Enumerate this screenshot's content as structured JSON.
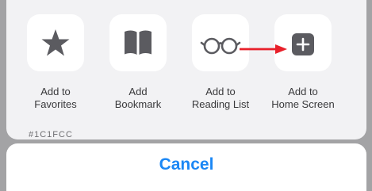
{
  "share_sheet": {
    "actions": [
      {
        "label": "Add to\nFavorites",
        "icon": "star-icon"
      },
      {
        "label": "Add\nBookmark",
        "icon": "book-icon"
      },
      {
        "label": "Add to\nReading List",
        "icon": "glasses-icon"
      },
      {
        "label": "Add to\nHome Screen",
        "icon": "plus-square-icon"
      }
    ],
    "peek_text": "#1C1FCC"
  },
  "cancel": {
    "label": "Cancel"
  },
  "annotation": {
    "arrow_icon": "red-arrow-icon",
    "arrow_color": "#e8202a"
  },
  "colors": {
    "accent": "#1b87f5",
    "icon_gray": "#5b5b60",
    "sheet_bg": "#f2f2f4",
    "backdrop": "#a3a3a5"
  }
}
